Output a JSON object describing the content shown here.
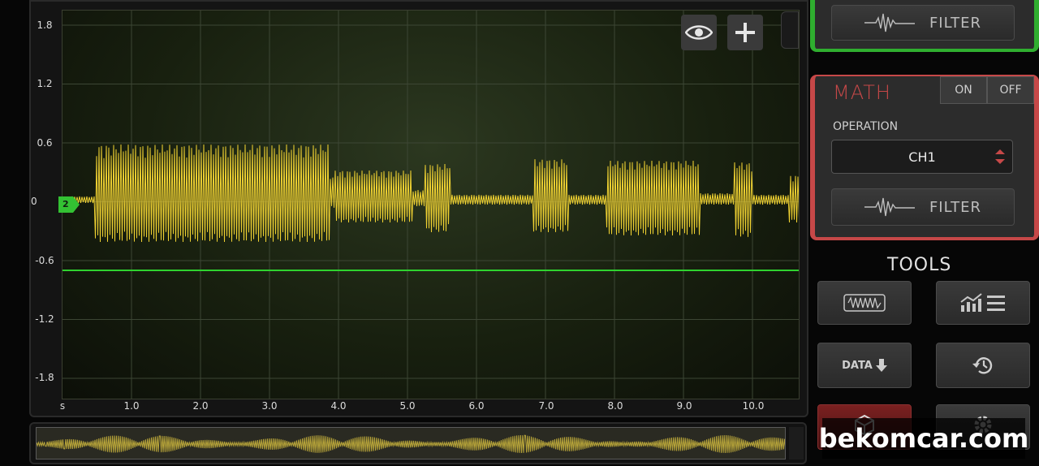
{
  "scope": {
    "y_ticks": [
      "1.8",
      "1.2",
      "0.6",
      "0",
      "-0.6",
      "-1.2",
      "-1.8"
    ],
    "x_unit": "s",
    "x_ticks": [
      "1.0",
      "2.0",
      "3.0",
      "4.0",
      "5.0",
      "6.0",
      "7.0",
      "8.0",
      "9.0",
      "10.0"
    ],
    "channel_marker": "2",
    "trace_color": "#f0d232",
    "trigger_color": "#2fd22f"
  },
  "toolbar": {
    "eye_icon": "eye-icon",
    "add_icon": "plus-icon"
  },
  "top_card": {
    "filter_label": "FILTER"
  },
  "math": {
    "title": "MATH",
    "on_label": "ON",
    "off_label": "OFF",
    "operation_label": "OPERATION",
    "operation_value": "CH1",
    "filter_label": "FILTER",
    "accent": "#c64848"
  },
  "tools": {
    "title": "TOOLS",
    "buttons": [
      {
        "icon": "waveform-icon"
      },
      {
        "icon": "measure-list-icon"
      },
      {
        "label": "DATA",
        "icon": "download-icon"
      },
      {
        "icon": "history-icon"
      },
      {
        "icon": "cube-icon"
      },
      {
        "icon": "gear-icon"
      }
    ]
  },
  "watermark": "bekomcar.com"
}
